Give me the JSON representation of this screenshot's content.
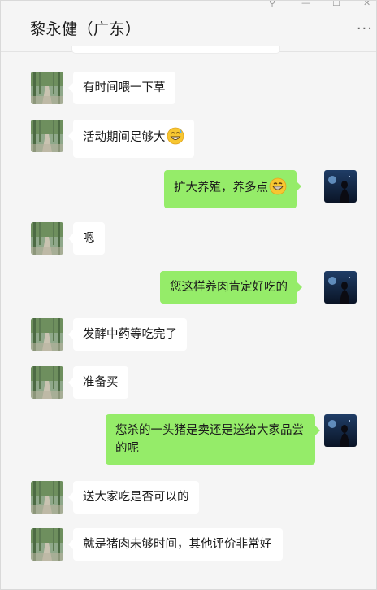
{
  "window": {
    "title": "黎永健（广东）",
    "more_label": "···",
    "controls": [
      "⚲",
      "—",
      "☐",
      "✕"
    ]
  },
  "colors": {
    "background": "#f5f5f5",
    "incoming_bubble": "#ffffff",
    "outgoing_bubble": "#95ec69"
  },
  "messages": [
    {
      "side": "left",
      "text": "有时间喂一下草"
    },
    {
      "side": "left",
      "text": "活动期间足够大",
      "emoji": "grinning-sweat-emoji"
    },
    {
      "side": "right",
      "text": "扩大养殖，养多点",
      "emoji": "grinning-emoji"
    },
    {
      "side": "left",
      "text": "嗯"
    },
    {
      "side": "right",
      "text": "您这样养肉肯定好吃的"
    },
    {
      "side": "left",
      "text": "发酵中药等吃完了"
    },
    {
      "side": "left",
      "text": "准备买"
    },
    {
      "side": "right",
      "text": "您杀的一头猪是卖还是送给大家品尝的呢"
    },
    {
      "side": "left",
      "text": "送大家吃是否可以的"
    },
    {
      "side": "left",
      "text": "就是猪肉未够时间，其他评价非常好"
    }
  ]
}
